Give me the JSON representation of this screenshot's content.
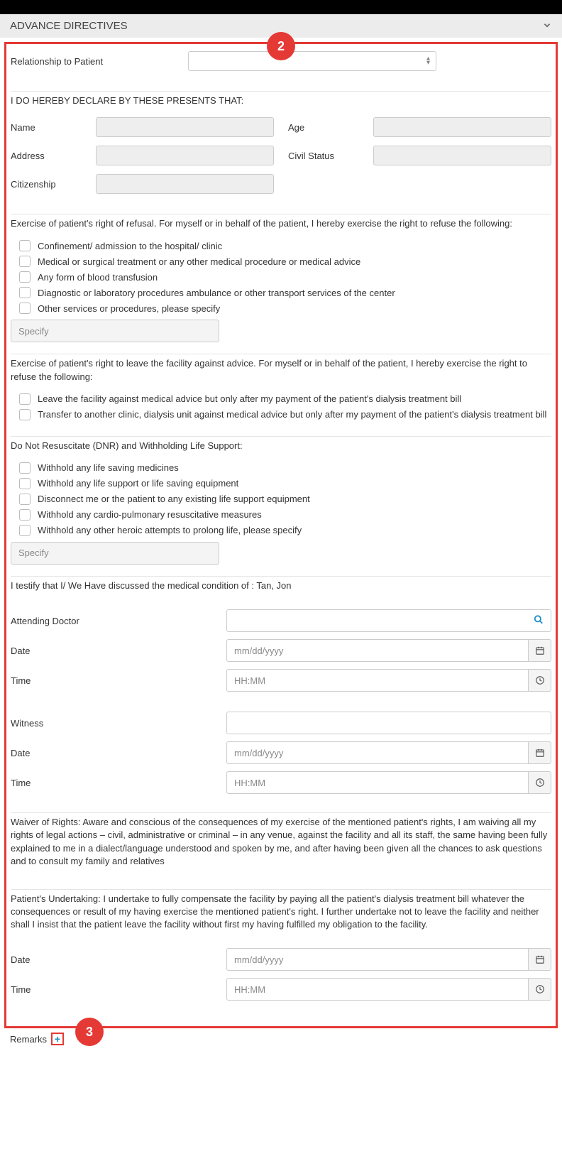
{
  "callouts": {
    "c2": "2",
    "c3": "3"
  },
  "panel_title": "ADVANCE DIRECTIVES",
  "relationship": {
    "label": "Relationship to Patient"
  },
  "declaration_intro": "I DO HEREBY DECLARE BY THESE PRESENTS THAT:",
  "fields": {
    "name": "Name",
    "age": "Age",
    "address": "Address",
    "civil_status": "Civil Status",
    "citizenship": "Citizenship"
  },
  "refusal": {
    "intro": "Exercise of patient's right of refusal. For myself or in behalf of the patient, I hereby exercise the right to refuse the following:",
    "opts": [
      "Confinement/ admission to the hospital/ clinic",
      "Medical or surgical treatment or any other medical procedure or medical advice",
      "Any form of blood transfusion",
      "Diagnostic or laboratory procedures ambulance or other transport services of the center",
      "Other services or procedures, please specify"
    ],
    "specify_ph": "Specify"
  },
  "leave": {
    "intro": "Exercise of patient's right to leave the facility against advice. For myself or in behalf of the patient, I hereby exercise the right to refuse the following:",
    "opts": [
      "Leave the facility against medical advice but only after my payment of the patient's dialysis treatment bill",
      "Transfer to another clinic, dialysis unit against medical advice but only after my payment of the patient's dialysis treatment bill"
    ]
  },
  "dnr": {
    "intro": "Do Not Resuscitate (DNR) and Withholding Life Support:",
    "opts": [
      "Withhold any life saving medicines",
      "Withhold any life support or life saving equipment",
      "Disconnect me or the patient to any existing life support equipment",
      "Withhold any cardio-pulmonary resuscitative measures",
      "Withhold any other heroic attempts to prolong life, please specify"
    ],
    "specify_ph": "Specify"
  },
  "testify": "I testify that I/ We Have discussed the medical condition of : Tan, Jon",
  "sig1": {
    "attending": "Attending Doctor",
    "date": "Date",
    "date_ph": "mm/dd/yyyy",
    "time": "Time",
    "time_ph": "HH:MM"
  },
  "sig2": {
    "witness": "Witness",
    "date": "Date",
    "date_ph": "mm/dd/yyyy",
    "time": "Time",
    "time_ph": "HH:MM"
  },
  "waiver": "Waiver of Rights: Aware and conscious of the consequences of my exercise of the mentioned patient's rights, I am waiving all my rights of legal actions – civil, administrative or criminal – in any venue, against the facility and all its staff, the same having been fully explained to me in a dialect/language understood and spoken by me, and after having been given all the chances to ask questions and to consult my family and relatives",
  "undertaking": "Patient's Undertaking: I undertake to fully compensate the facility by paying all the patient's dialysis treatment bill whatever the consequences or result of my having exercise the mentioned patient's right. I further undertake not to leave the facility and neither shall I insist that the patient leave the facility without first my having fulfilled my obligation to the facility.",
  "sig3": {
    "date": "Date",
    "date_ph": "mm/dd/yyyy",
    "time": "Time",
    "time_ph": "HH:MM"
  },
  "remarks": {
    "label": "Remarks",
    "plus": "+"
  }
}
